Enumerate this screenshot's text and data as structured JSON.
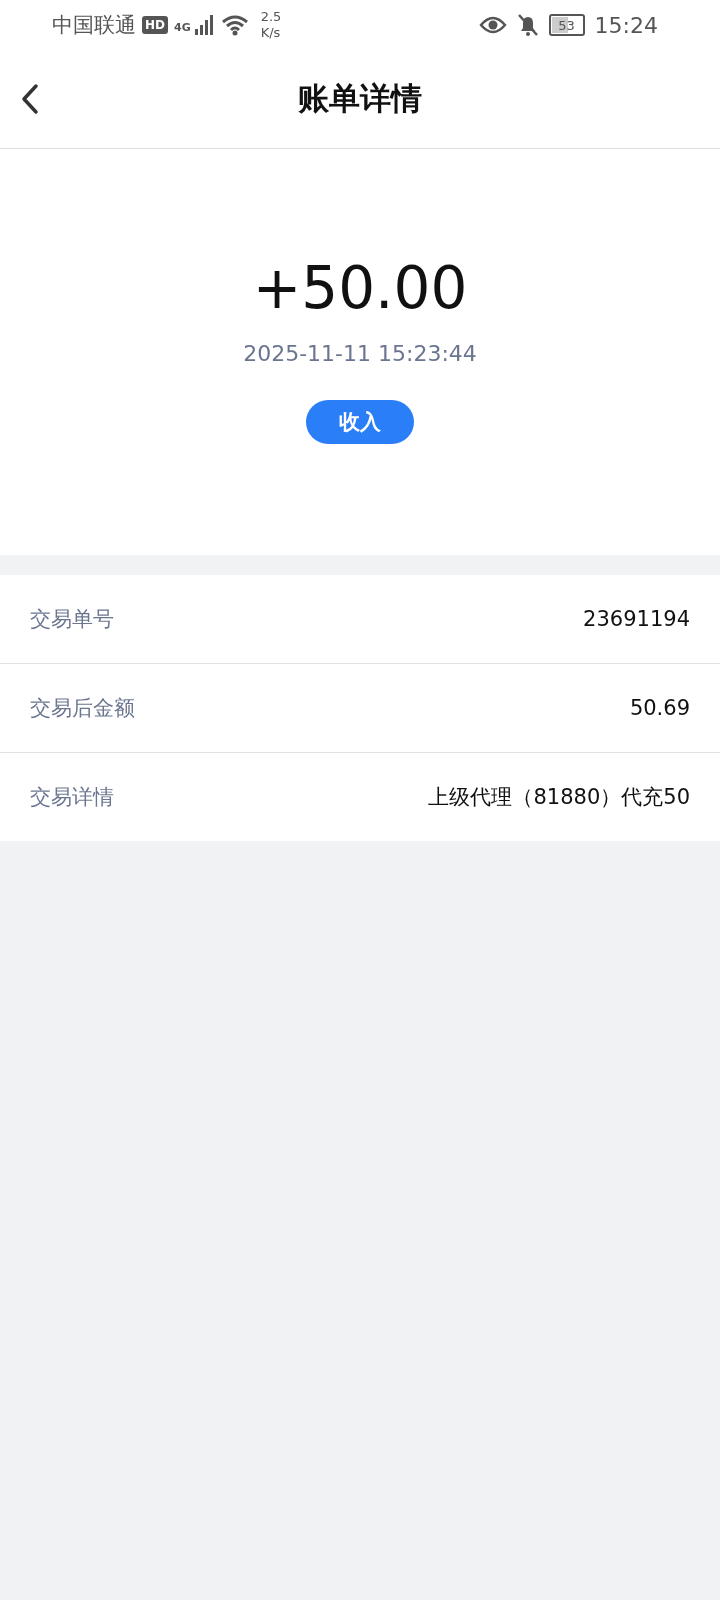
{
  "status_bar": {
    "carrier": "中国联通",
    "hd": "HD",
    "network": "4G",
    "speed_value": "2.5",
    "speed_unit": "K/s",
    "battery": "53",
    "time": "15:24"
  },
  "header": {
    "title": "账单详情"
  },
  "summary": {
    "amount": "+50.00",
    "datetime": "2025-11-11 15:23:44",
    "type_badge": "收入"
  },
  "details": [
    {
      "label": "交易单号",
      "value": "23691194"
    },
    {
      "label": "交易后金额",
      "value": "50.69"
    },
    {
      "label": "交易详情",
      "value": "上级代理（81880）代充50"
    }
  ]
}
